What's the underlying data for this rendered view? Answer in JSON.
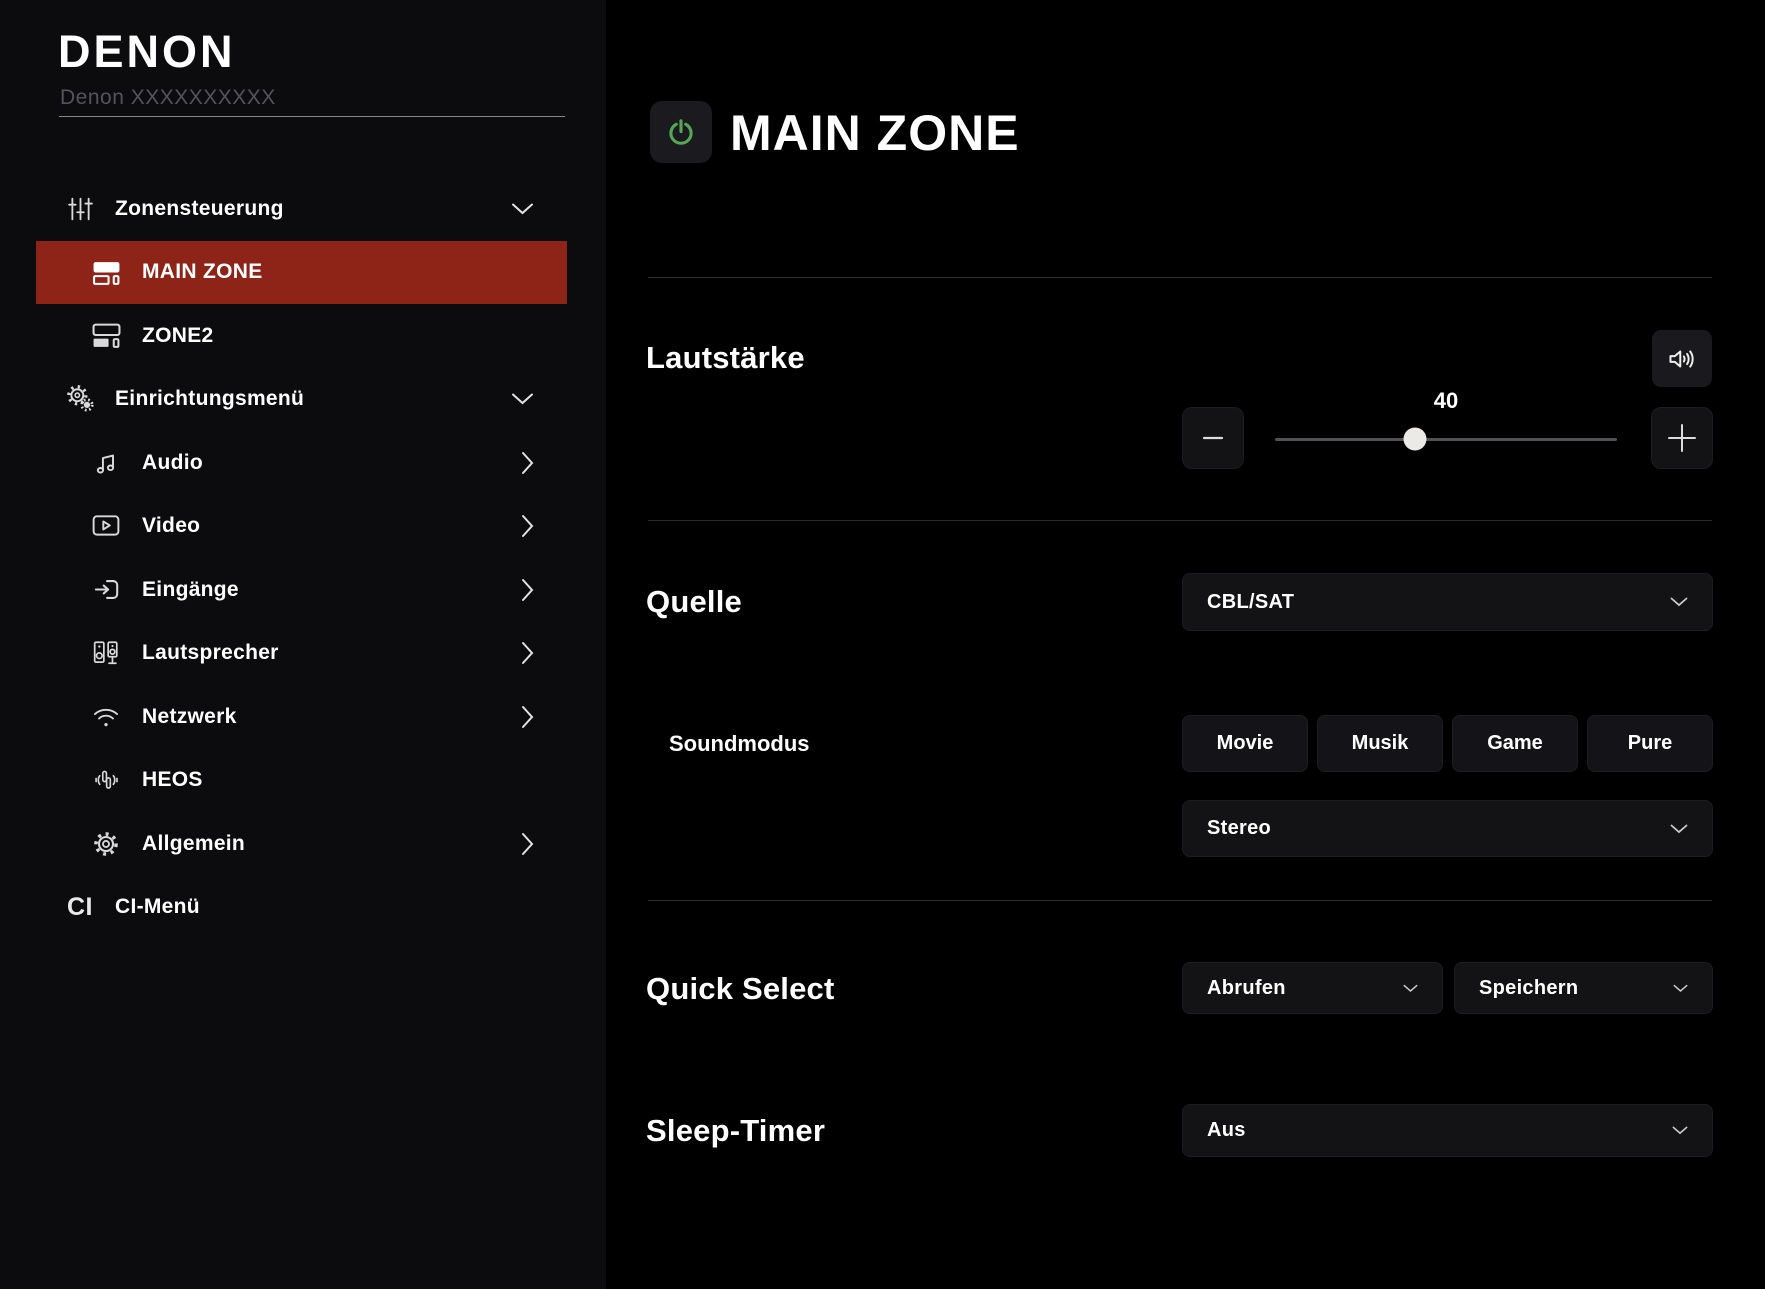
{
  "brand": {
    "logo": "DENON",
    "model": "Denon XXXXXXXXXX"
  },
  "sidebar": {
    "items": [
      {
        "label": "Zonensteuerung",
        "icon": "sliders-icon",
        "level": "section",
        "chevron": "down",
        "active": false
      },
      {
        "label": "MAIN ZONE",
        "icon": "zone-icon",
        "level": "sub",
        "chevron": "none",
        "active": true
      },
      {
        "label": "ZONE2",
        "icon": "zone2-icon",
        "level": "sub",
        "chevron": "none",
        "active": false
      },
      {
        "label": "Einrichtungsmenü",
        "icon": "gears-icon",
        "level": "section",
        "chevron": "down",
        "active": false
      },
      {
        "label": "Audio",
        "icon": "music-note-icon",
        "level": "sub",
        "chevron": "right",
        "active": false
      },
      {
        "label": "Video",
        "icon": "video-icon",
        "level": "sub",
        "chevron": "right",
        "active": false
      },
      {
        "label": "Eingänge",
        "icon": "input-icon",
        "level": "sub",
        "chevron": "right",
        "active": false
      },
      {
        "label": "Lautsprecher",
        "icon": "speakers-icon",
        "level": "sub",
        "chevron": "right",
        "active": false
      },
      {
        "label": "Netzwerk",
        "icon": "wifi-icon",
        "level": "sub",
        "chevron": "right",
        "active": false
      },
      {
        "label": "HEOS",
        "icon": "heos-icon",
        "level": "sub",
        "chevron": "none",
        "active": false
      },
      {
        "label": "Allgemein",
        "icon": "gear-icon",
        "level": "sub",
        "chevron": "right",
        "active": false
      },
      {
        "label": "CI-Menü",
        "icon": "ci-icon",
        "level": "section",
        "chevron": "none",
        "active": false
      }
    ],
    "ci_glyph": "CI"
  },
  "main": {
    "title": "MAIN ZONE",
    "volume": {
      "heading": "Lautstärke",
      "value": "40",
      "percent": 41
    },
    "source": {
      "heading": "Quelle",
      "selected": "CBL/SAT"
    },
    "sound_mode": {
      "label": "Soundmodus",
      "buttons": [
        "Movie",
        "Musik",
        "Game",
        "Pure"
      ],
      "selected": "Stereo"
    },
    "quick_select": {
      "heading": "Quick Select",
      "recall": "Abrufen",
      "store": "Speichern"
    },
    "sleep_timer": {
      "heading": "Sleep-Timer",
      "selected": "Aus"
    }
  },
  "colors": {
    "active_item_red": "#8e2318",
    "power_green": "#57a657",
    "sidebar_bg": "#0c0b0e",
    "main_bg": "#000000",
    "panel_bg": "#131215",
    "divider": "#2c2c2e"
  }
}
